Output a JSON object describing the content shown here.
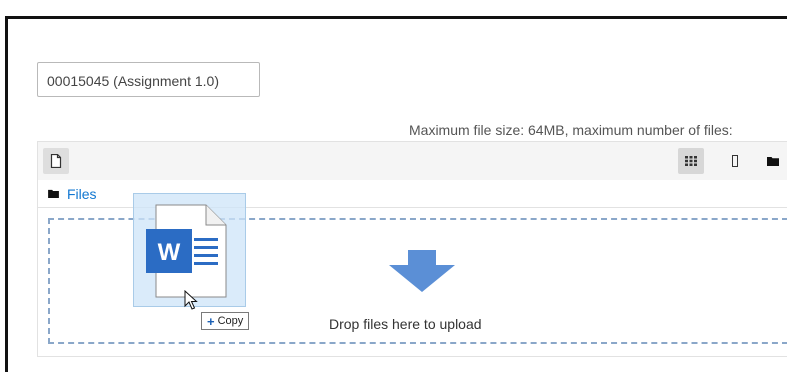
{
  "submission": {
    "name": "00015045 (Assignment 1.0)"
  },
  "filepicker": {
    "max_size_text": "Maximum file size: 64MB, maximum number of files:",
    "path_label": "Files",
    "drop_text": "Drop files here to upload",
    "views": [
      "icons-view-icon",
      "list-view-icon",
      "tree-view-icon"
    ],
    "active_view": "icons-view-icon"
  },
  "drag": {
    "file_type_icon": "word-document-icon",
    "copy_label": "Copy"
  },
  "colors": {
    "link": "#1177d1",
    "dropzone_border": "#8aa7c9",
    "arrow": "#5b8fd6",
    "word_blue": "#2b6cc4"
  }
}
